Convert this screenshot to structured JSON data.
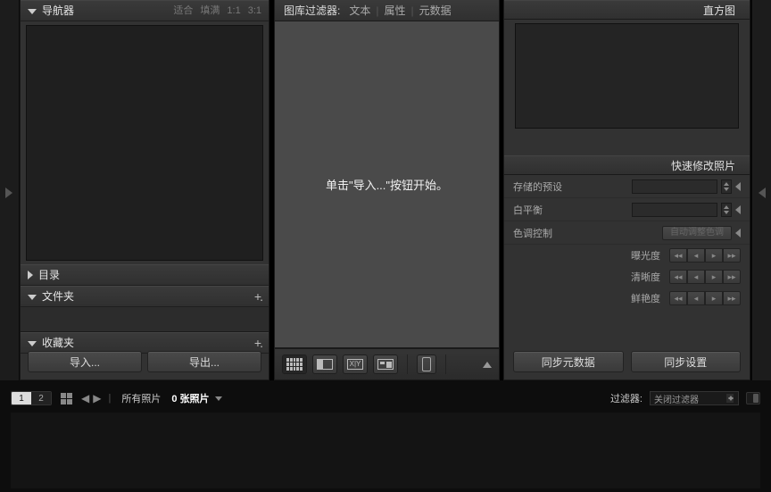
{
  "left": {
    "navigator": {
      "title": "导航器",
      "fit": "适合",
      "fill": "填满",
      "r1": "1:1",
      "r2": "3:1"
    },
    "catalog": "目录",
    "folders": "文件夹",
    "collections": "收藏夹",
    "import_btn": "导入...",
    "export_btn": "导出..."
  },
  "center": {
    "filter_label": "图库过滤器:",
    "filter_text": "文本",
    "filter_attr": "属性",
    "filter_meta": "元数据",
    "placeholder": "单击\"导入...\"按钮开始。"
  },
  "right": {
    "histogram": "直方图",
    "quick": "快速修改照片",
    "preset": "存储的预设",
    "wb": "白平衡",
    "tone": "色调控制",
    "auto_tone": "自动调整色调",
    "exposure": "曝光度",
    "clarity": "清晰度",
    "vibrance": "鲜艳度",
    "sync_meta": "同步元数据",
    "sync_settings": "同步设置"
  },
  "film": {
    "seg1": "1",
    "seg2": "2",
    "crumb_all": "所有照片",
    "count": "0 张照片",
    "filter_label": "过滤器:",
    "filter_off": "关闭过滤器"
  }
}
